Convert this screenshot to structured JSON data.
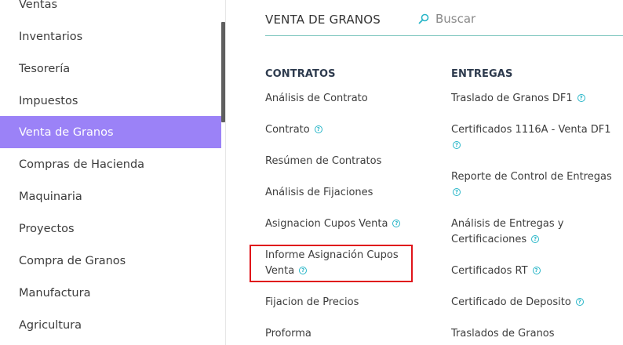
{
  "sidebar": {
    "items": [
      {
        "label": "Ventas"
      },
      {
        "label": "Inventarios"
      },
      {
        "label": "Tesorería"
      },
      {
        "label": "Impuestos"
      },
      {
        "label": "Venta de Granos"
      },
      {
        "label": "Compras de Hacienda"
      },
      {
        "label": "Maquinaria"
      },
      {
        "label": "Proyectos"
      },
      {
        "label": "Compra de Granos"
      },
      {
        "label": "Manufactura"
      },
      {
        "label": "Agricultura"
      }
    ],
    "active_index": 4,
    "active_color": "#9b82f7"
  },
  "header": {
    "title": "VENTA DE GRANOS",
    "search_placeholder": "Buscar",
    "search_icon": "search-icon"
  },
  "contratos": {
    "title": "CONTRATOS",
    "items": [
      {
        "label": "Análisis de Contrato"
      },
      {
        "label": "Contrato"
      },
      {
        "label": "Resúmen de Contratos"
      },
      {
        "label": "Análisis de Fijaciones"
      },
      {
        "label": "Asignacion Cupos Venta"
      },
      {
        "label_line1": "Informe Asignación Cupos",
        "label_line2": "Venta"
      },
      {
        "label": "Fijacion de Precios"
      },
      {
        "label": "Proforma"
      }
    ]
  },
  "entregas": {
    "title": "ENTREGAS",
    "items": [
      {
        "label": "Traslado de Granos DF1"
      },
      {
        "label": "Certificados 1116A - Venta DF1"
      },
      {
        "label": "Reporte de Control de Entregas"
      },
      {
        "label_line1": "Análisis de Entregas y",
        "label_line2": "Certificaciones"
      },
      {
        "label": "Certificados RT"
      },
      {
        "label": "Certificado de Deposito"
      },
      {
        "label": "Traslados de Granos"
      }
    ]
  },
  "help_glyph": "?",
  "colors": {
    "accent": "#29b6c8",
    "highlight": "#e0141a",
    "rule": "#7fc7bf"
  }
}
